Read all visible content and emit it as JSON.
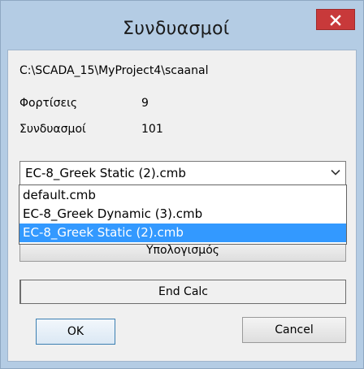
{
  "window": {
    "title": "Συνδυασμοί",
    "close_label": "×"
  },
  "info": {
    "path": "C:\\SCADA_15\\MyProject4\\scaanal",
    "loads_label": "Φορτίσεις",
    "loads_value": "9",
    "combos_label": "Συνδυασμοί",
    "combos_value": "101"
  },
  "combo": {
    "selected": "EC-8_Greek Static (2).cmb",
    "options": [
      "default.cmb",
      "EC-8_Greek Dynamic (3).cmb",
      "EC-8_Greek Static (2).cmb"
    ],
    "highlighted_index": 2
  },
  "buttons": {
    "calculate": "Υπολογισμός",
    "end_calc": "End Calc",
    "ok": "OK",
    "cancel": "Cancel"
  },
  "colors": {
    "close": "#c8393a",
    "highlight": "#3399ff",
    "frame": "#b4cce4"
  },
  "icons": {
    "close": "close-icon",
    "dropdown": "chevron-down-icon"
  }
}
